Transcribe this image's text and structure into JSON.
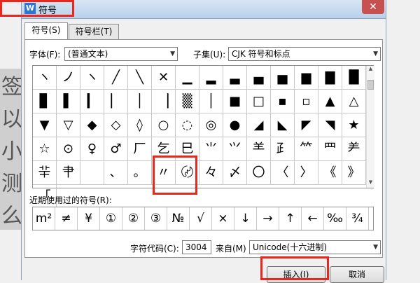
{
  "window": {
    "title": "符号",
    "app_icon_glyph": "W",
    "close_glyph": "✕"
  },
  "tabs": [
    {
      "label": "符号(S)"
    },
    {
      "label": "符号栏(T)"
    }
  ],
  "font": {
    "label": "字体(F):",
    "value": "(普通文本)"
  },
  "subset": {
    "label": "子集(U):",
    "value": "CJK 符号和标点"
  },
  "symbols": [
    "ヽ",
    "ノ",
    "ヽ",
    "╱",
    "╲",
    "✕",
    "▁",
    "▂",
    "▃",
    "▄",
    "▅",
    "▆",
    "▇",
    "█",
    "▊",
    "▌",
    "▎",
    "▏",
    "│",
    "▕",
    "▒",
    "│",
    "■",
    "□",
    "▪",
    "▫",
    "▲",
    "△",
    "▼",
    "▽",
    "◆",
    "◇",
    "◊",
    "○",
    "◌",
    "◎",
    "●",
    "◢",
    "◣",
    "◤",
    "◥",
    "★",
    "☆",
    "⊙",
    "♀",
    "♂",
    "厂",
    "乞",
    "巳",
    "⺌",
    "⺍",
    "⺷",
    "⺪",
    "⺮",
    "⺲",
    "⺶",
    "⺸",
    "⺺",
    "",
    "、",
    "。",
    "〃",
    "〄",
    "々",
    "〆",
    "〇",
    "〈",
    "〉",
    "《",
    "》",
    "「"
  ],
  "recent": {
    "label": "近期使用过的符号(R):",
    "items": [
      "m²",
      "≠",
      "¥",
      "①",
      "②",
      "③",
      "№",
      "√",
      "×",
      "↓",
      "→",
      "↑",
      "←",
      "‰",
      "¾"
    ]
  },
  "char_code": {
    "label": "字符代码(C):",
    "value": "3004"
  },
  "from": {
    "label": "来自(M)",
    "value": "Unicode(十六进制)"
  },
  "buttons": {
    "insert": "插入(I)",
    "cancel": "取消"
  },
  "background_doc": [
    "签",
    "以",
    "小",
    "测",
    "么"
  ],
  "accent": {
    "highlight": "#e8281e"
  }
}
